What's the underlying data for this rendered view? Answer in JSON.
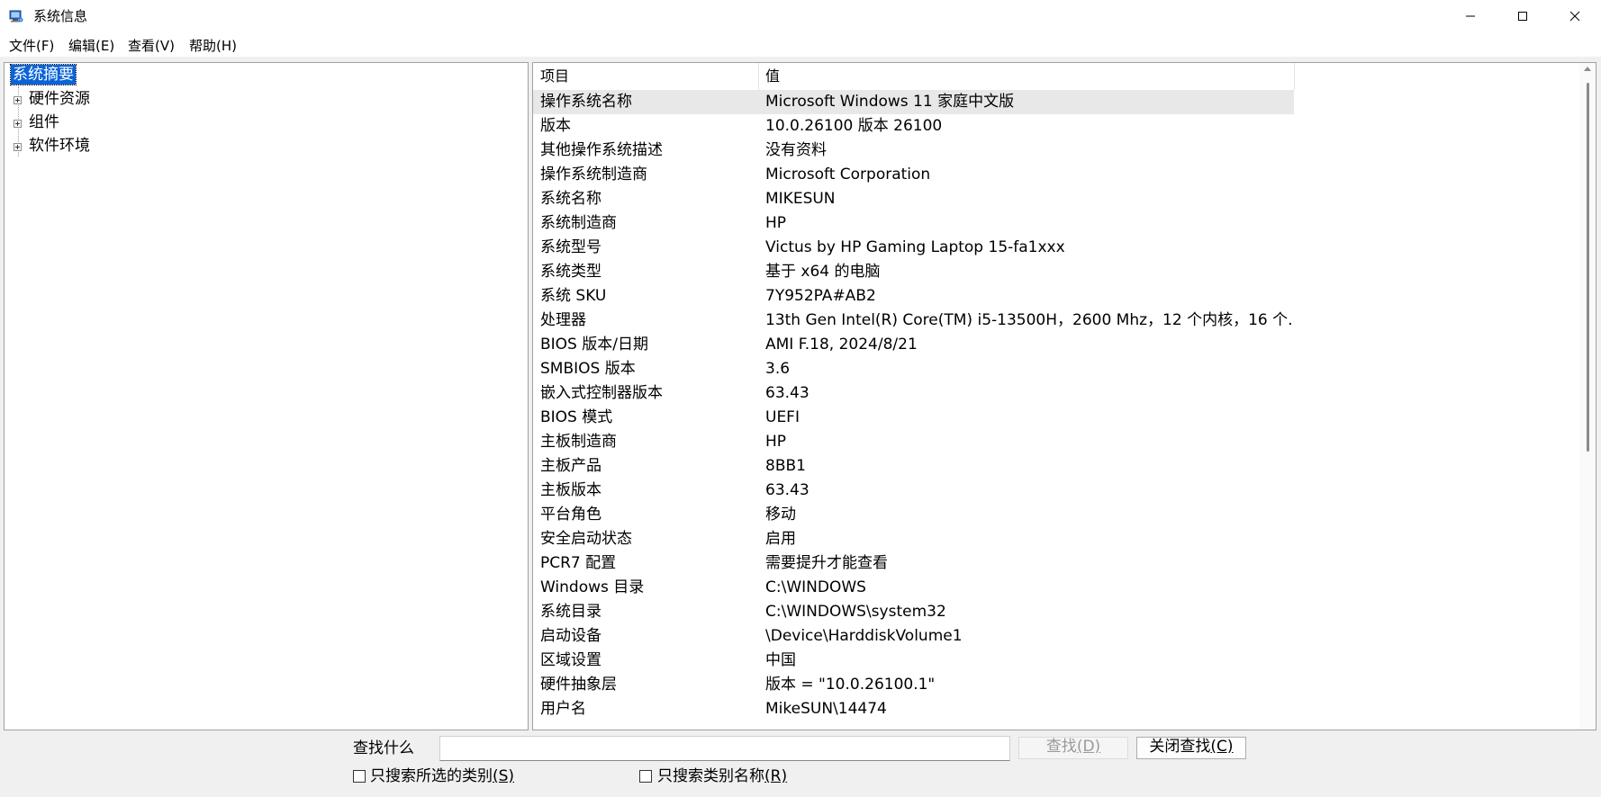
{
  "window": {
    "title": "系统信息",
    "icon": "system-information-icon"
  },
  "menu": [
    {
      "label": "文件(F)"
    },
    {
      "label": "编辑(E)"
    },
    {
      "label": "查看(V)"
    },
    {
      "label": "帮助(H)"
    }
  ],
  "tree": {
    "root": "系统摘要",
    "children": [
      {
        "label": "硬件资源"
      },
      {
        "label": "组件"
      },
      {
        "label": "软件环境"
      }
    ]
  },
  "list": {
    "headers": {
      "item": "项目",
      "value": "值"
    },
    "rows": [
      {
        "item": "操作系统名称",
        "value": "Microsoft Windows 11 家庭中文版"
      },
      {
        "item": "版本",
        "value": "10.0.26100 版本 26100"
      },
      {
        "item": "其他操作系统描述",
        "value": "没有资料"
      },
      {
        "item": "操作系统制造商",
        "value": "Microsoft Corporation"
      },
      {
        "item": "系统名称",
        "value": "MIKESUN"
      },
      {
        "item": "系统制造商",
        "value": "HP"
      },
      {
        "item": "系统型号",
        "value": "Victus by HP Gaming Laptop 15-fa1xxx"
      },
      {
        "item": "系统类型",
        "value": "基于 x64 的电脑"
      },
      {
        "item": "系统 SKU",
        "value": "7Y952PA#AB2"
      },
      {
        "item": "处理器",
        "value": "13th Gen Intel(R) Core(TM) i5-13500H，2600 Mhz，12 个内核，16 个..."
      },
      {
        "item": "BIOS 版本/日期",
        "value": "AMI F.18, 2024/8/21"
      },
      {
        "item": "SMBIOS 版本",
        "value": "3.6"
      },
      {
        "item": "嵌入式控制器版本",
        "value": "63.43"
      },
      {
        "item": "BIOS 模式",
        "value": "UEFI"
      },
      {
        "item": "主板制造商",
        "value": "HP"
      },
      {
        "item": "主板产品",
        "value": "8BB1"
      },
      {
        "item": "主板版本",
        "value": "63.43"
      },
      {
        "item": "平台角色",
        "value": "移动"
      },
      {
        "item": "安全启动状态",
        "value": "启用"
      },
      {
        "item": "PCR7 配置",
        "value": "需要提升才能查看"
      },
      {
        "item": "Windows 目录",
        "value": "C:\\WINDOWS"
      },
      {
        "item": "系统目录",
        "value": "C:\\WINDOWS\\system32"
      },
      {
        "item": "启动设备",
        "value": "\\Device\\HarddiskVolume1"
      },
      {
        "item": "区域设置",
        "value": "中国"
      },
      {
        "item": "硬件抽象层",
        "value": "版本 = \"10.0.26100.1\""
      },
      {
        "item": "用户名",
        "value": "MikeSUN\\14474"
      }
    ]
  },
  "find": {
    "label": "查找什么",
    "input_value": "",
    "find_button": {
      "text": "查找",
      "key": "(D)"
    },
    "close_button": {
      "text": "关闭查找",
      "key": "(C)"
    },
    "checkbox_selected": {
      "text": "只搜索所选的类别",
      "key": "(S)",
      "checked": false
    },
    "checkbox_names": {
      "text": "只搜索类别名称",
      "key": "(R)",
      "checked": false
    }
  },
  "colors": {
    "selection": "#0a64d7",
    "row_highlight": "#e8e8e8",
    "background": "#f0f0f0"
  }
}
